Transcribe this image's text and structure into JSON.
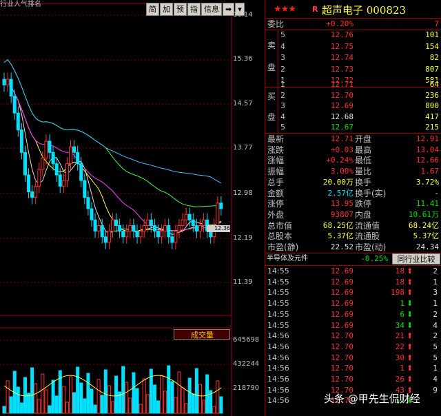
{
  "chart": {
    "title_clip": "行业人气排名",
    "price_axis": [
      "16.14",
      "15.36",
      "14.57",
      "13.77",
      "12.98",
      "12.19",
      "11.39"
    ],
    "current_marker": "12.36",
    "vol_axis": [
      "645698",
      "432244",
      "218790"
    ],
    "vol_header": "成交量",
    "toolbar": [
      "简",
      "加",
      "预",
      "指",
      "信息",
      "➡",
      "▾"
    ]
  },
  "quote": {
    "stars": "★★★",
    "flag": "R",
    "name": "超声电子 000823",
    "weibi_label": "委比",
    "weibi_pct": "+0.20%",
    "weibi_diff": "7",
    "sell_side_label": [
      "卖",
      "盘"
    ],
    "buy_side_label": [
      "买",
      "盘"
    ],
    "asks": [
      {
        "lvl": "5",
        "price": "12.76",
        "vol": "101"
      },
      {
        "lvl": "4",
        "price": "12.75",
        "vol": "154"
      },
      {
        "lvl": "3",
        "price": "12.74",
        "vol": "82"
      },
      {
        "lvl": "2",
        "price": "12.73",
        "vol": "807"
      },
      {
        "lvl": "1",
        "price": "12.72",
        "vol": "581"
      }
    ],
    "bids": [
      {
        "lvl": "1",
        "price": "12.71",
        "vol": "64"
      },
      {
        "lvl": "2",
        "price": "12.70",
        "vol": "236"
      },
      {
        "lvl": "3",
        "price": "12.69",
        "vol": "800"
      },
      {
        "lvl": "4",
        "price": "12.68",
        "vol": "417"
      },
      {
        "lvl": "5",
        "price": "12.67",
        "vol": "215"
      }
    ],
    "stats": [
      {
        "l": "最新",
        "v": "12.71",
        "vc": "red",
        "l2": "开盘",
        "v2": "12.91",
        "v2c": "red"
      },
      {
        "l": "涨跌",
        "v": "+0.03",
        "vc": "red",
        "l2": "最高",
        "v2": "13.04",
        "v2c": "red"
      },
      {
        "l": "涨幅",
        "v": "+0.24%",
        "vc": "red",
        "l2": "最低",
        "v2": "12.66",
        "v2c": "red"
      },
      {
        "l": "振幅",
        "v": "3.00%",
        "vc": "red",
        "l2": "量比",
        "v2": "1.67",
        "v2c": "red"
      },
      {
        "l": "总手",
        "v": "20.00万",
        "vc": "yellow",
        "l2": "换手",
        "v2": "3.72%",
        "v2c": "yellow"
      },
      {
        "l": "金额",
        "v": "2.57亿",
        "vc": "cyan",
        "l2": "换手(实)",
        "v2": "-",
        "v2c": "white"
      },
      {
        "l": "涨停",
        "v": "13.95",
        "vc": "red",
        "l2": "跌停",
        "v2": "11.41",
        "v2c": "green"
      },
      {
        "l": "外盘",
        "v": "93807",
        "vc": "red",
        "l2": "内盘",
        "v2": "10.61万",
        "v2c": "green"
      },
      {
        "l": "总市值",
        "v": "68.25亿",
        "vc": "yellow",
        "l2": "流通值",
        "v2": "68.24亿",
        "v2c": "yellow"
      },
      {
        "l": "总股本",
        "v": "5.37亿",
        "vc": "yellow",
        "l2": "流通股",
        "v2": "5.37亿",
        "v2c": "yellow"
      },
      {
        "l": "市盈(静)",
        "v": "22.52",
        "vc": "white",
        "l2": "市盈(动)",
        "v2": "24.34",
        "v2c": "white"
      }
    ],
    "sector_name": "半导体及元件",
    "sector_change": "-0.25%",
    "compare_button": "同行业比较"
  },
  "ticks": [
    {
      "t": "14:55",
      "p": "12.69",
      "v": "18",
      "dir": "up",
      "n": "2"
    },
    {
      "t": "14:55",
      "p": "12.69",
      "v": "18",
      "dir": "up",
      "n": "1"
    },
    {
      "t": "14:55",
      "p": "12.69",
      "v": "198",
      "dir": "up",
      "n": "3"
    },
    {
      "t": "14:55",
      "p": "12.69",
      "v": "1",
      "dir": "down",
      "n": "1"
    },
    {
      "t": "14:55",
      "p": "12.69",
      "v": "6",
      "dir": "down",
      "n": "2"
    },
    {
      "t": "14:55",
      "p": "12.69",
      "v": "34",
      "dir": "down",
      "n": "4"
    },
    {
      "t": "14:56",
      "p": "12.70",
      "v": "21",
      "dir": "up",
      "n": "2"
    },
    {
      "t": "14:56",
      "p": "12.70",
      "v": "22",
      "dir": "up",
      "n": "5"
    },
    {
      "t": "14:56",
      "p": "12.70",
      "v": "30",
      "dir": "up",
      "n": "5"
    },
    {
      "t": "14:56",
      "p": "12.70",
      "v": "1",
      "dir": "up",
      "n": "1"
    },
    {
      "t": "14:56",
      "p": "12.70",
      "v": "26",
      "dir": "up",
      "n": "4"
    },
    {
      "t": "14:56",
      "p": "12.70",
      "v": "43",
      "dir": "up",
      "n": "9"
    },
    {
      "t": "14:56",
      "p": "12.70",
      "v": "51",
      "dir": "down",
      "n": ""
    }
  ],
  "watermark": "头条 @甲先生侃财经",
  "colors": {
    "up": "#ff3030",
    "down": "#00e000",
    "accent": "#ffff40",
    "grid": "#a00000"
  }
}
